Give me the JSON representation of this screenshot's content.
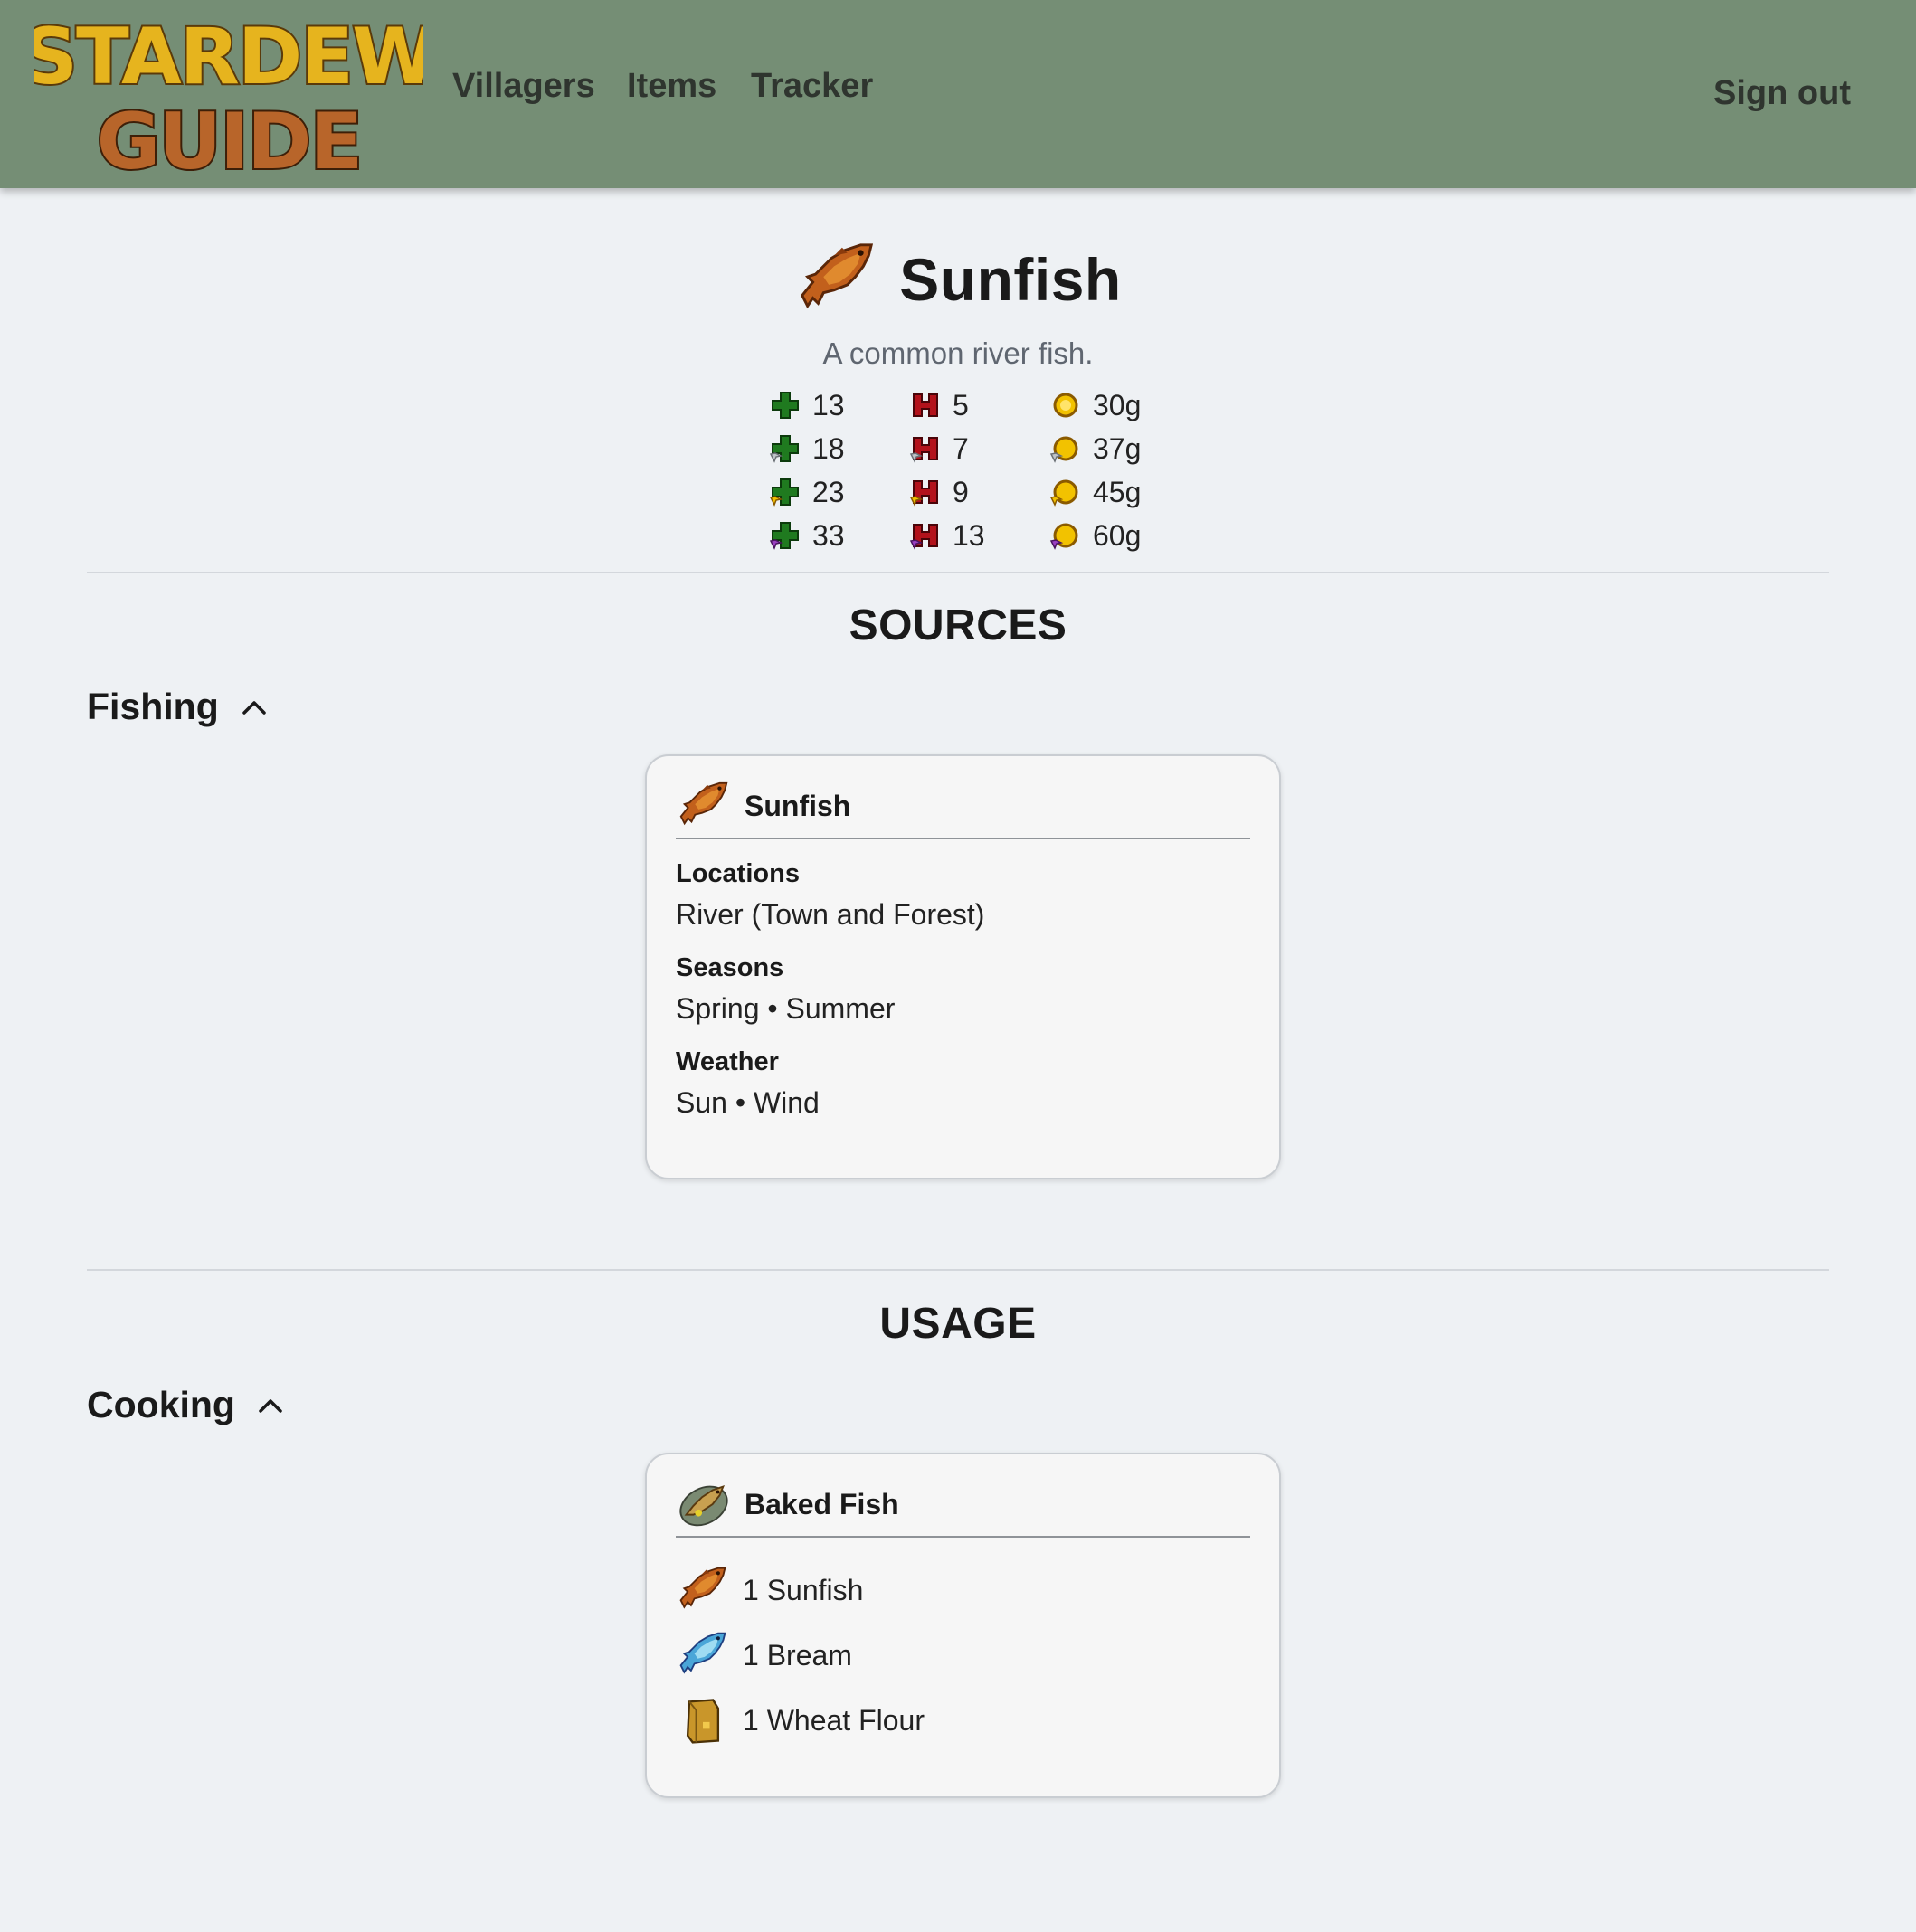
{
  "app": {
    "logo_line1": "STARDEW",
    "logo_line2": "GUIDE",
    "nav": [
      "Villagers",
      "Items",
      "Tracker"
    ],
    "sign_out": "Sign out"
  },
  "item": {
    "name": "Sunfish",
    "description": "A common river fish.",
    "icon": "sunfish-icon",
    "stats": {
      "energy": [
        "13",
        "18",
        "23",
        "33"
      ],
      "health": [
        "5",
        "7",
        "9",
        "13"
      ],
      "price": [
        "30g",
        "37g",
        "45g",
        "60g"
      ],
      "quality_tiers": [
        "base",
        "silver",
        "gold",
        "iridium"
      ]
    }
  },
  "sources": {
    "title": "SOURCES",
    "group": "Fishing",
    "card": {
      "name": "Sunfish",
      "icon": "sunfish-icon",
      "locations_label": "Locations",
      "locations": "River (Town and Forest)",
      "seasons_label": "Seasons",
      "seasons": "Spring • Summer",
      "weather_label": "Weather",
      "weather": "Sun • Wind"
    }
  },
  "usage": {
    "title": "USAGE",
    "group": "Cooking",
    "card": {
      "name": "Baked Fish",
      "icon": "baked-fish-icon",
      "ingredients": [
        {
          "label": "1 Sunfish",
          "icon": "sunfish-icon"
        },
        {
          "label": "1 Bream",
          "icon": "bream-icon"
        },
        {
          "label": "1 Wheat Flour",
          "icon": "wheat-flour-icon"
        }
      ]
    }
  },
  "colors": {
    "navbar": "#758e75",
    "background": "#eef1f4",
    "energy": "#1f7a1f",
    "health": "#b3121b",
    "gold": "#f2c200",
    "silver": "#bfc4c9",
    "iridium": "#9b3fc2"
  }
}
